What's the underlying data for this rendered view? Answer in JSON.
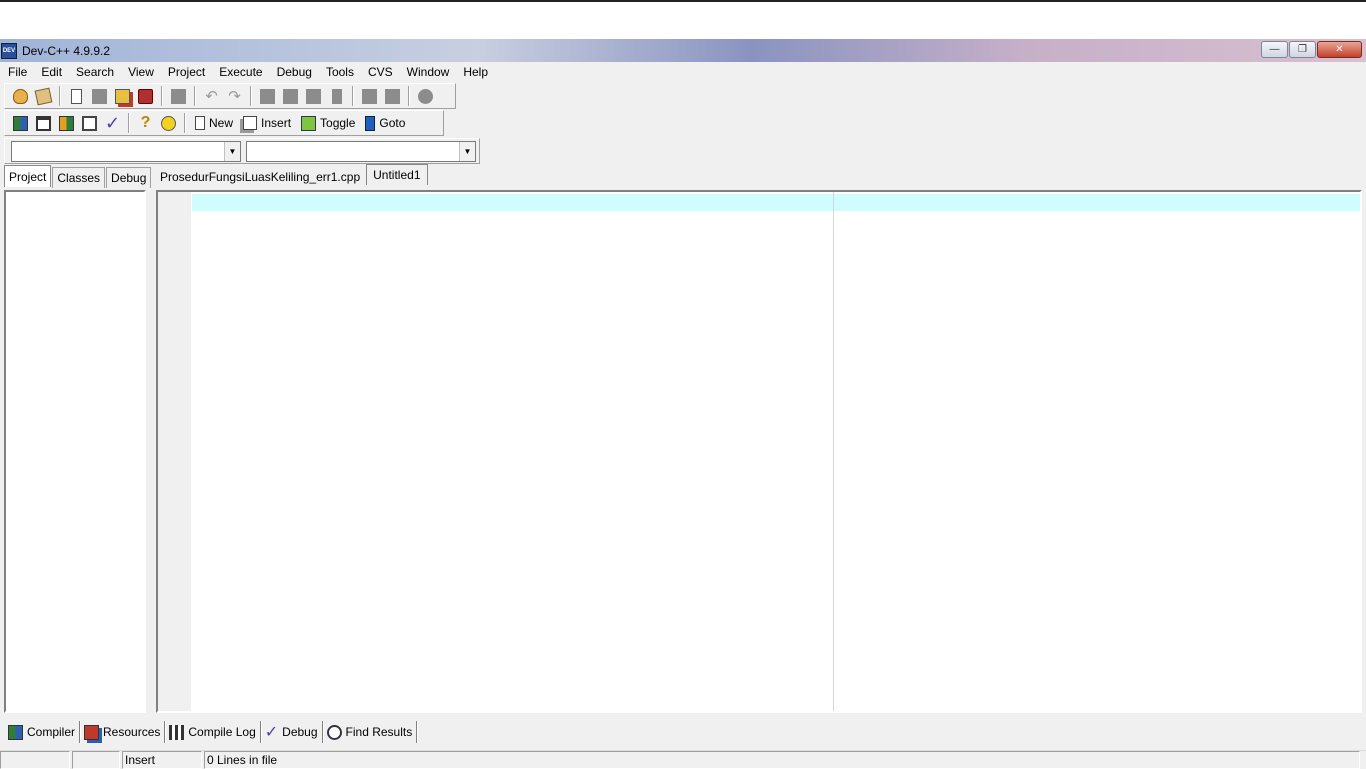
{
  "window": {
    "title": "Dev-C++ 4.9.9.2",
    "app_icon_text": "DEV"
  },
  "menu": [
    "File",
    "Edit",
    "Search",
    "View",
    "Project",
    "Execute",
    "Debug",
    "Tools",
    "CVS",
    "Window",
    "Help"
  ],
  "toolbar2": {
    "new_label": "New",
    "insert_label": "Insert",
    "toggle_label": "Toggle",
    "goto_label": "Goto"
  },
  "left_tabs": [
    "Project",
    "Classes",
    "Debug"
  ],
  "file_tabs": [
    "ProsedurFungsiLuasKeliling_err1.cpp",
    "Untitled1"
  ],
  "bottom_tabs": [
    "Compiler",
    "Resources",
    "Compile Log",
    "Debug",
    "Find Results"
  ],
  "status": {
    "pane1": "",
    "pane2": "",
    "mode": "Insert",
    "lines": "0 Lines in file"
  },
  "colors": {
    "current_line": "#cffcfc",
    "editor_bg": "#ffffff",
    "gutter": "#f0f0f0"
  }
}
